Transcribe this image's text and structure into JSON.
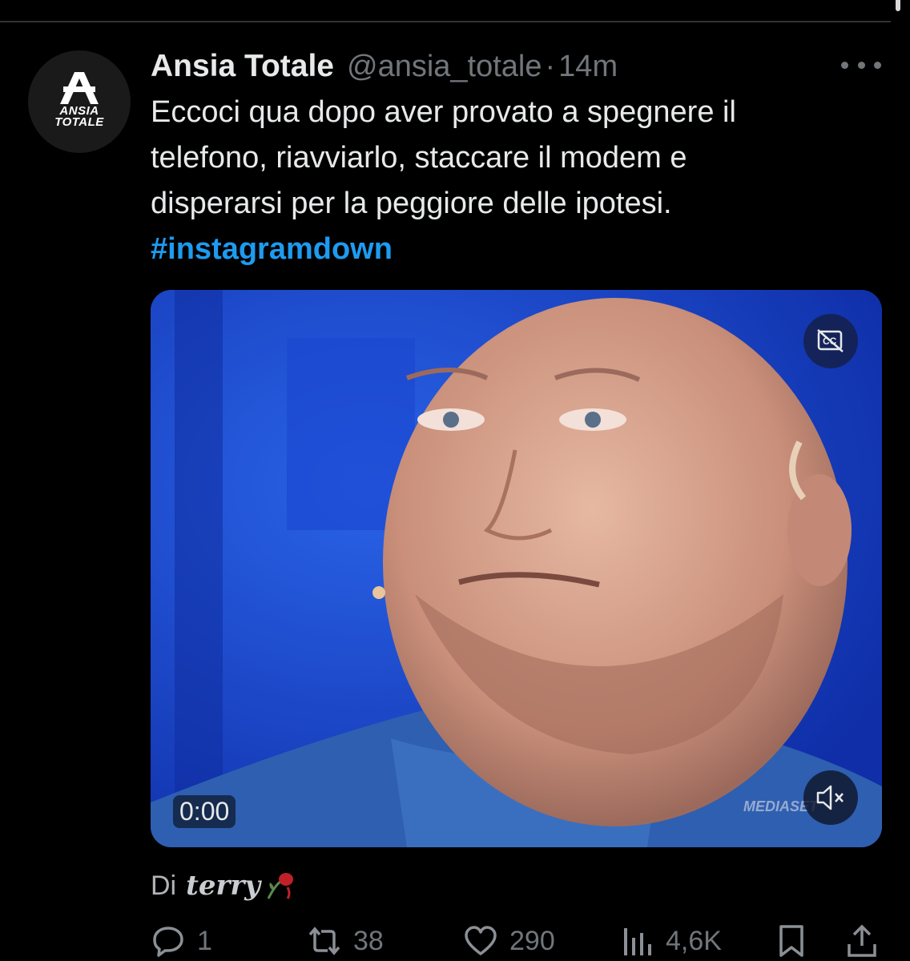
{
  "tweet": {
    "display_name": "Ansia Totale",
    "handle": "@ansia_totale",
    "separator": "·",
    "time": "14m",
    "avatar_text_line1": "ANSIA",
    "avatar_text_line2": "TOTALE",
    "text_lines": [
      "Eccoci qua dopo aver provato a spegnere il",
      "telefono, riavviarlo, staccare il modem e",
      "disperarsi per la peggiore delle ipotesi."
    ],
    "hashtag": "#instagramdown"
  },
  "media": {
    "timestamp": "0:00",
    "watermark": "MEDIASET",
    "captions_icon": "captions-off-icon",
    "mute_icon": "volume-muted-icon",
    "background_color": "#1640c8"
  },
  "attribution": {
    "prefix": "Di",
    "author": "terry"
  },
  "actions": {
    "reply_count": "1",
    "retweet_count": "38",
    "like_count": "290",
    "views_count": "4,6K"
  },
  "colors": {
    "background": "#000000",
    "text_primary": "#e7e9ea",
    "text_secondary": "#71767b",
    "link": "#1d9bf0"
  }
}
